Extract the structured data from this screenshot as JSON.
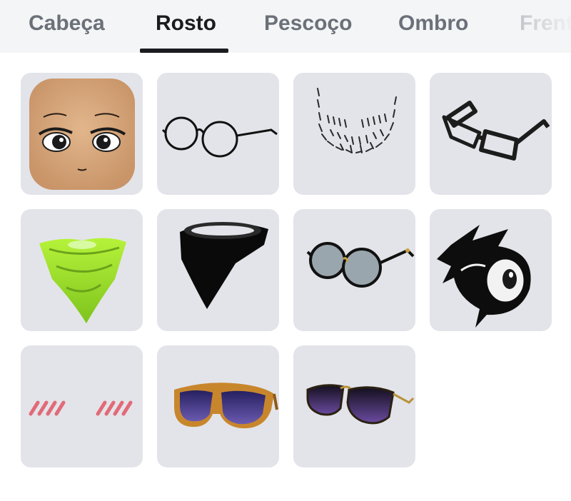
{
  "tabs": [
    {
      "label": "Cabeça",
      "active": false
    },
    {
      "label": "Rosto",
      "active": true
    },
    {
      "label": "Pescoço",
      "active": false
    },
    {
      "label": "Ombro",
      "active": false
    },
    {
      "label": "Frent",
      "active": false
    }
  ],
  "items": [
    {
      "icon": "face-avatar-icon"
    },
    {
      "icon": "round-glasses-icon"
    },
    {
      "icon": "stubble-beard-icon"
    },
    {
      "icon": "rectangle-glasses-icon"
    },
    {
      "icon": "green-bandana-icon"
    },
    {
      "icon": "black-bandana-icon"
    },
    {
      "icon": "round-tinted-sunglasses-icon"
    },
    {
      "icon": "dark-eye-mask-icon"
    },
    {
      "icon": "blush-marks-icon"
    },
    {
      "icon": "orange-frame-sunglasses-icon"
    },
    {
      "icon": "aviator-sunglasses-icon"
    }
  ],
  "colors": {
    "tab_active": "#1a1c20",
    "tab_inactive": "#6b7079",
    "tile_background": "#e3e4e9",
    "tab_bar_background": "#f4f5f6"
  }
}
